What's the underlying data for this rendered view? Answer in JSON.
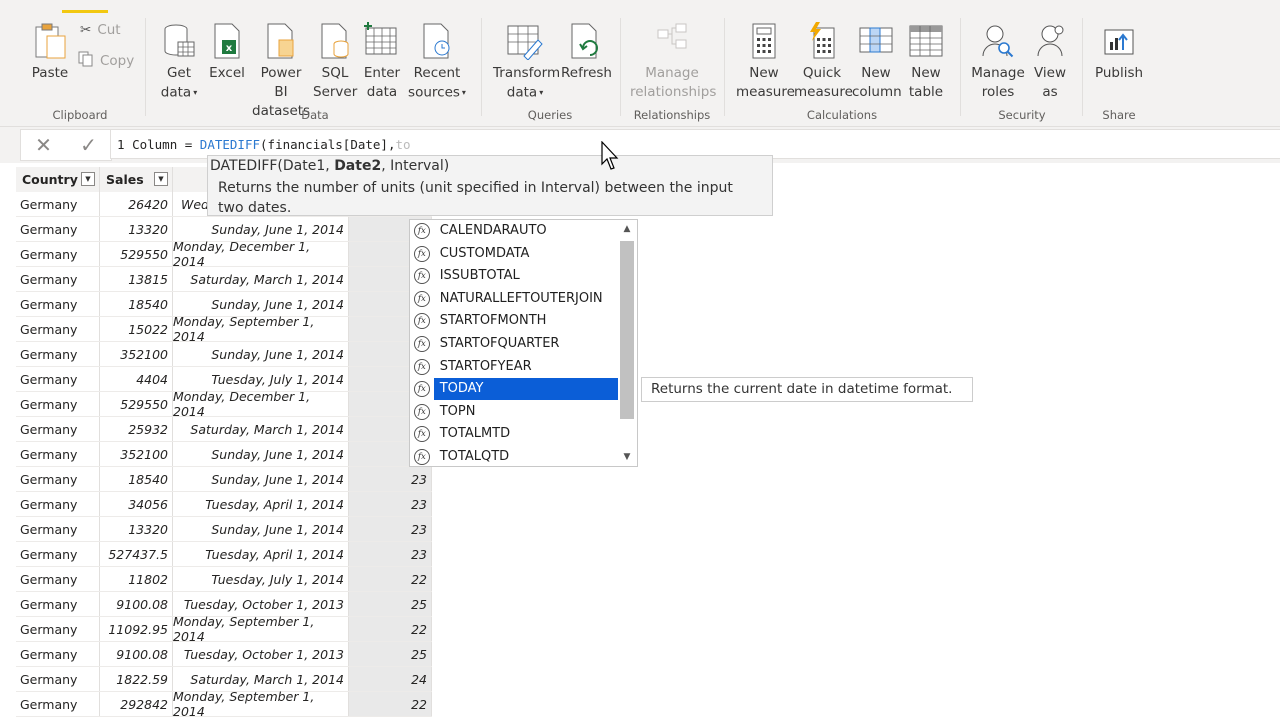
{
  "ribbon": {
    "groups": {
      "clipboard": "Clipboard",
      "data": "Data",
      "queries": "Queries",
      "relationships": "Relationships",
      "calculations": "Calculations",
      "security": "Security",
      "share": "Share"
    },
    "buttons": {
      "paste": "Paste",
      "cut": "Cut",
      "copy": "Copy",
      "get_data": [
        "Get",
        "data"
      ],
      "excel": "Excel",
      "powerbi": [
        "Power BI",
        "datasets"
      ],
      "sql": [
        "SQL",
        "Server"
      ],
      "enter_data": [
        "Enter",
        "data"
      ],
      "recent_sources": [
        "Recent",
        "sources"
      ],
      "transform": [
        "Transform",
        "data"
      ],
      "refresh": "Refresh",
      "manage_relationships": [
        "Manage",
        "relationships"
      ],
      "new_measure": [
        "New",
        "measure"
      ],
      "quick_measure": [
        "Quick",
        "measure"
      ],
      "new_column": [
        "New",
        "column"
      ],
      "new_table": [
        "New",
        "table"
      ],
      "manage_roles": [
        "Manage",
        "roles"
      ],
      "view_as": [
        "View",
        "as"
      ],
      "publish": "Publish"
    }
  },
  "formula": {
    "line_number": "1",
    "prefix": "Column = ",
    "func": "DATEDIFF",
    "args": "(financials[Date],",
    "typed": "to"
  },
  "signature_tip": {
    "func": "DATEDIFF(",
    "p1": "Date1, ",
    "p2": "Date2",
    "p3": ", Interval)",
    "description": "Returns the number of units (unit specified in Interval) between the input two dates."
  },
  "table": {
    "headers": [
      "Country",
      "Sales"
    ],
    "rows": [
      [
        "Germany",
        "26420",
        "Wed",
        ""
      ],
      [
        "Germany",
        "13320",
        "Sunday, June 1, 2014",
        ""
      ],
      [
        "Germany",
        "529550",
        "Monday, December 1, 2014",
        ""
      ],
      [
        "Germany",
        "13815",
        "Saturday, March 1, 2014",
        ""
      ],
      [
        "Germany",
        "18540",
        "Sunday, June 1, 2014",
        ""
      ],
      [
        "Germany",
        "15022",
        "Monday, September 1, 2014",
        ""
      ],
      [
        "Germany",
        "352100",
        "Sunday, June 1, 2014",
        ""
      ],
      [
        "Germany",
        "4404",
        "Tuesday, July 1, 2014",
        ""
      ],
      [
        "Germany",
        "529550",
        "Monday, December 1, 2014",
        ""
      ],
      [
        "Germany",
        "25932",
        "Saturday, March 1, 2014",
        ""
      ],
      [
        "Germany",
        "352100",
        "Sunday, June 1, 2014",
        ""
      ],
      [
        "Germany",
        "18540",
        "Sunday, June 1, 2014",
        "23"
      ],
      [
        "Germany",
        "34056",
        "Tuesday, April 1, 2014",
        "23"
      ],
      [
        "Germany",
        "13320",
        "Sunday, June 1, 2014",
        "23"
      ],
      [
        "Germany",
        "527437.5",
        "Tuesday, April 1, 2014",
        "23"
      ],
      [
        "Germany",
        "11802",
        "Tuesday, July 1, 2014",
        "22"
      ],
      [
        "Germany",
        "9100.08",
        "Tuesday, October 1, 2013",
        "25"
      ],
      [
        "Germany",
        "11092.95",
        "Monday, September 1, 2014",
        "22"
      ],
      [
        "Germany",
        "9100.08",
        "Tuesday, October 1, 2013",
        "25"
      ],
      [
        "Germany",
        "1822.59",
        "Saturday, March 1, 2014",
        "24"
      ],
      [
        "Germany",
        "292842",
        "Monday, September 1, 2014",
        "22"
      ]
    ]
  },
  "autocomplete": {
    "items": [
      "CALENDARAUTO",
      "CUSTOMDATA",
      "ISSUBTOTAL",
      "NATURALLEFTOUTERJOIN",
      "STARTOFMONTH",
      "STARTOFQUARTER",
      "STARTOFYEAR",
      "TODAY",
      "TOPN",
      "TOTALMTD",
      "TOTALQTD"
    ],
    "selected_index": 7,
    "selected_description": "Returns the current date in datetime format."
  },
  "colors": {
    "accent": "#f2c811",
    "selection": "#0b5ed7",
    "keyword": "#2b79d0"
  }
}
